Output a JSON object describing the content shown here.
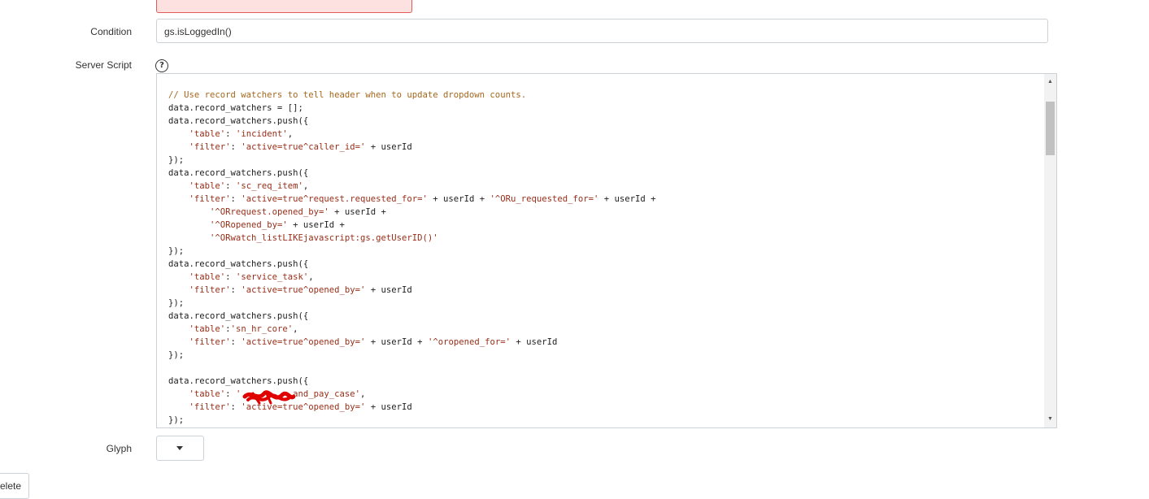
{
  "condition": {
    "label": "Condition",
    "value": "gs.isLoggedIn()"
  },
  "server_script": {
    "label": "Server Script",
    "help_icon": "question-circle-icon",
    "code_lines": [
      {
        "indent": "",
        "parts": [
          {
            "t": "cm",
            "v": "// Use record watchers to tell header when to update dropdown counts."
          }
        ]
      },
      {
        "indent": "",
        "parts": [
          {
            "t": "",
            "v": "data.record_watchers = [];"
          }
        ]
      },
      {
        "indent": "",
        "parts": [
          {
            "t": "",
            "v": "data.record_watchers.push({"
          }
        ]
      },
      {
        "indent": "    ",
        "parts": [
          {
            "t": "str",
            "v": "'table'"
          },
          {
            "t": "",
            "v": ": "
          },
          {
            "t": "str",
            "v": "'incident'"
          },
          {
            "t": "",
            "v": ","
          }
        ]
      },
      {
        "indent": "    ",
        "parts": [
          {
            "t": "str",
            "v": "'filter'"
          },
          {
            "t": "",
            "v": ": "
          },
          {
            "t": "str",
            "v": "'active=true^caller_id='"
          },
          {
            "t": "",
            "v": " + userId"
          }
        ]
      },
      {
        "indent": "",
        "parts": [
          {
            "t": "",
            "v": "});"
          }
        ]
      },
      {
        "indent": "",
        "parts": [
          {
            "t": "",
            "v": "data.record_watchers.push({"
          }
        ]
      },
      {
        "indent": "    ",
        "parts": [
          {
            "t": "str",
            "v": "'table'"
          },
          {
            "t": "",
            "v": ": "
          },
          {
            "t": "str",
            "v": "'sc_req_item'"
          },
          {
            "t": "",
            "v": ","
          }
        ]
      },
      {
        "indent": "    ",
        "parts": [
          {
            "t": "str",
            "v": "'filter'"
          },
          {
            "t": "",
            "v": ": "
          },
          {
            "t": "str",
            "v": "'active=true^request.requested_for='"
          },
          {
            "t": "",
            "v": " + userId + "
          },
          {
            "t": "str",
            "v": "'^ORu_requested_for='"
          },
          {
            "t": "",
            "v": " + userId +"
          }
        ]
      },
      {
        "indent": "        ",
        "parts": [
          {
            "t": "str",
            "v": "'^ORrequest.opened_by='"
          },
          {
            "t": "",
            "v": " + userId +"
          }
        ]
      },
      {
        "indent": "        ",
        "parts": [
          {
            "t": "str",
            "v": "'^ORopened_by='"
          },
          {
            "t": "",
            "v": " + userId +"
          }
        ]
      },
      {
        "indent": "        ",
        "parts": [
          {
            "t": "str",
            "v": "'^ORwatch_listLIKEjavascript:gs.getUserID()'"
          }
        ]
      },
      {
        "indent": "",
        "parts": [
          {
            "t": "",
            "v": "});"
          }
        ]
      },
      {
        "indent": "",
        "parts": [
          {
            "t": "",
            "v": "data.record_watchers.push({"
          }
        ]
      },
      {
        "indent": "    ",
        "parts": [
          {
            "t": "str",
            "v": "'table'"
          },
          {
            "t": "",
            "v": ": "
          },
          {
            "t": "str",
            "v": "'service_task'"
          },
          {
            "t": "",
            "v": ","
          }
        ]
      },
      {
        "indent": "    ",
        "parts": [
          {
            "t": "str",
            "v": "'filter'"
          },
          {
            "t": "",
            "v": ": "
          },
          {
            "t": "str",
            "v": "'active=true^opened_by='"
          },
          {
            "t": "",
            "v": " + userId"
          }
        ]
      },
      {
        "indent": "",
        "parts": [
          {
            "t": "",
            "v": "});"
          }
        ]
      },
      {
        "indent": "",
        "parts": [
          {
            "t": "",
            "v": "data.record_watchers.push({"
          }
        ]
      },
      {
        "indent": "    ",
        "parts": [
          {
            "t": "str",
            "v": "'table'"
          },
          {
            "t": "",
            "v": ":"
          },
          {
            "t": "str",
            "v": "'sn_hr_core'"
          },
          {
            "t": "",
            "v": ","
          }
        ]
      },
      {
        "indent": "    ",
        "parts": [
          {
            "t": "str",
            "v": "'filter'"
          },
          {
            "t": "",
            "v": ": "
          },
          {
            "t": "str",
            "v": "'active=true^opened_by='"
          },
          {
            "t": "",
            "v": " + userId + "
          },
          {
            "t": "str",
            "v": "'^oropened_for='"
          },
          {
            "t": "",
            "v": " + userId"
          }
        ]
      },
      {
        "indent": "",
        "parts": [
          {
            "t": "",
            "v": "});"
          }
        ]
      },
      {
        "indent": "",
        "parts": [
          {
            "t": "",
            "v": ""
          }
        ]
      },
      {
        "indent": "",
        "parts": [
          {
            "t": "",
            "v": "data.record_watchers.push({"
          }
        ]
      },
      {
        "indent": "    ",
        "parts": [
          {
            "t": "str",
            "v": "'table'"
          },
          {
            "t": "",
            "v": ": "
          },
          {
            "t": "str",
            "v": "'         _and_pay_case'"
          },
          {
            "t": "",
            "v": ","
          }
        ]
      },
      {
        "indent": "    ",
        "parts": [
          {
            "t": "str",
            "v": "'filter'"
          },
          {
            "t": "",
            "v": ": "
          },
          {
            "t": "str",
            "v": "'active=true^opened_by='"
          },
          {
            "t": "",
            "v": " + userId"
          }
        ]
      },
      {
        "indent": "",
        "parts": [
          {
            "t": "",
            "v": "});"
          }
        ]
      }
    ],
    "scroll_position": 0.0
  },
  "glyph": {
    "label": "Glyph",
    "dropdown_icon": "caret-down-icon"
  },
  "delete_button": {
    "label": "elete"
  },
  "colors": {
    "comment": "#a5671c",
    "string": "#9a2e19",
    "error_box_bg": "#fde0e0",
    "error_box_border": "#e25b5b",
    "redaction": "#e00000"
  }
}
